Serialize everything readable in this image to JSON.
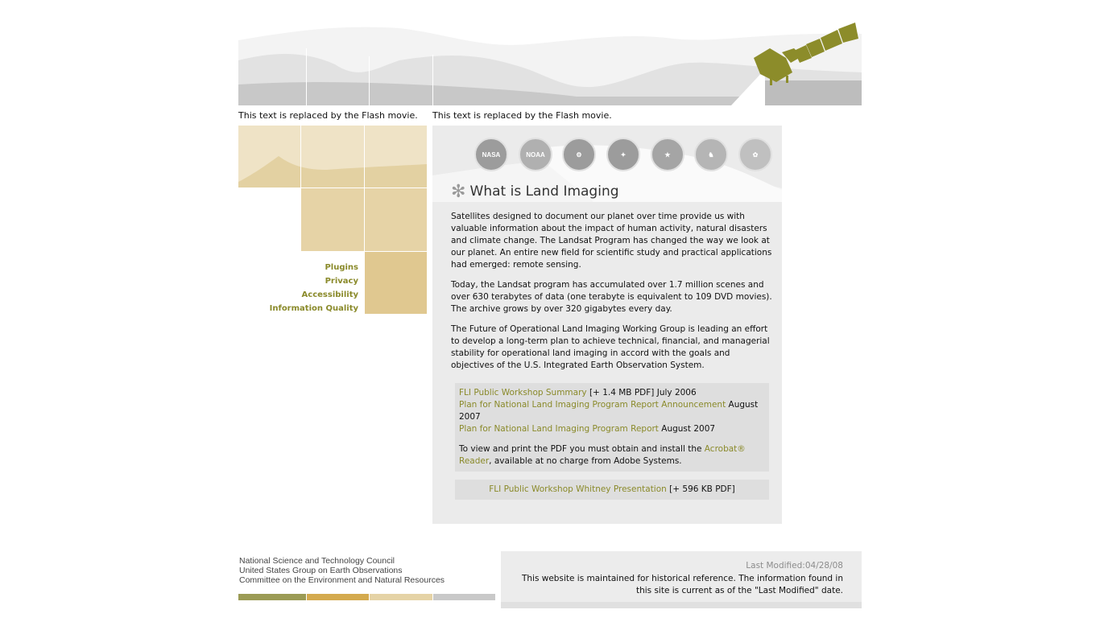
{
  "flash": {
    "left_text": "This text is replaced by the Flash movie.",
    "right_text": "This text is replaced by the Flash movie."
  },
  "left_nav": {
    "items": [
      {
        "label": "Plugins"
      },
      {
        "label": "Privacy"
      },
      {
        "label": "Accessibility"
      },
      {
        "label": "Information Quality"
      }
    ]
  },
  "seals": [
    {
      "name": "nasa-seal-icon",
      "label": "NASA"
    },
    {
      "name": "noaa-seal-icon",
      "label": "NOAA"
    },
    {
      "name": "doe-seal-icon",
      "label": ""
    },
    {
      "name": "state-seal-icon",
      "label": ""
    },
    {
      "name": "dod-seal-icon",
      "label": ""
    },
    {
      "name": "doi-seal-icon",
      "label": ""
    },
    {
      "name": "usda-seal-icon",
      "label": ""
    }
  ],
  "main": {
    "title": "What is Land Imaging",
    "paragraphs": [
      "Satellites designed to document our planet over time provide us with valuable information about the impact of human activity, natural disasters and climate change. The Landsat Program has changed the way we look at our planet. An entire new field for scientific study and practical applications had emerged: remote sensing.",
      "Today, the Landsat program has accumulated over 1.7 million scenes and over 630 terabytes of data (one terabyte is equivalent to 109 DVD movies). The archive grows by over 320 gigabytes every day.",
      "The Future of Operational Land Imaging Working Group is leading an effort to develop a long-term plan to achieve technical, financial, and managerial stability for operational land imaging in accord with the goals and objectives of the U.S. Integrated Earth Observation System."
    ],
    "pdf_box": {
      "link1": "FLI Public Workshop Summary",
      "link1_suffix": " [+ 1.4 MB PDF] July 2006",
      "link2": "Plan for National Land Imaging Program Report Announcement",
      "link2_suffix": " August 2007",
      "link3": "Plan for National Land Imaging Program Report",
      "link3_suffix": " August 2007",
      "reader_prefix": "To view and print the PDF you must obtain and install the ",
      "reader_link": "Acrobat® Reader",
      "reader_suffix": ", available at no charge from Adobe Systems."
    },
    "whitney": {
      "link": "FLI Public Workshop Whitney Presentation",
      "suffix": " [+ 596 KB PDF]"
    }
  },
  "footer": {
    "org_lines": [
      "National Science and Technology Council",
      "United States Group on Earth Observations",
      "Committee on the Environment and Natural Resources"
    ],
    "bar_colors": [
      "#9b9b55",
      "#d4aa4e",
      "#e5d3a6",
      "#c9c9c9"
    ],
    "last_modified": "Last Modified:04/28/08",
    "note": "This website is maintained for historical reference. The information found in this site is current as of the \"Last Modified\" date."
  },
  "colors": {
    "olive_link": "#8a8a2a",
    "satellite": "#8c8c2a",
    "content_bg": "#ebebeb"
  }
}
